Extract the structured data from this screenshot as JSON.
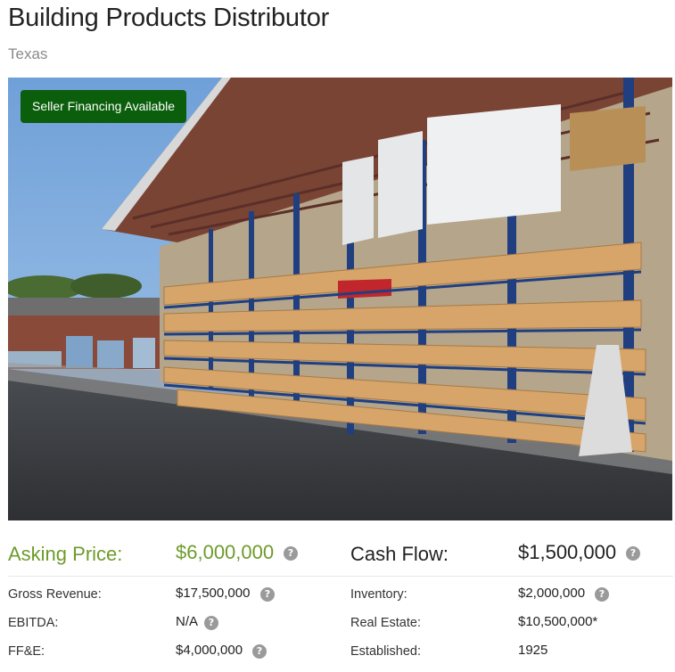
{
  "listing": {
    "title": "Building Products Distributor",
    "location": "Texas",
    "badge": "Seller Financing Available"
  },
  "financials": {
    "asking_price_label": "Asking Price:",
    "asking_price_value": "$6,000,000",
    "cash_flow_label": "Cash Flow:",
    "cash_flow_value": "$1,500,000",
    "gross_revenue_label": "Gross Revenue:",
    "gross_revenue_value": "$17,500,000",
    "ebitda_label": "EBITDA:",
    "ebitda_value": "N/A",
    "ffe_label": "FF&E:",
    "ffe_value": "$4,000,000",
    "inventory_label": "Inventory:",
    "inventory_value": "$2,000,000",
    "real_estate_label": "Real Estate:",
    "real_estate_value": "$10,500,000*",
    "established_label": "Established:",
    "established_value": "1925"
  },
  "icons": {
    "help": "question-circle-icon",
    "help_glyph": "?"
  },
  "colors": {
    "accent_green": "#6e9b2b",
    "badge_green": "#0b5e0b",
    "help_gray": "#9a9a9a"
  }
}
